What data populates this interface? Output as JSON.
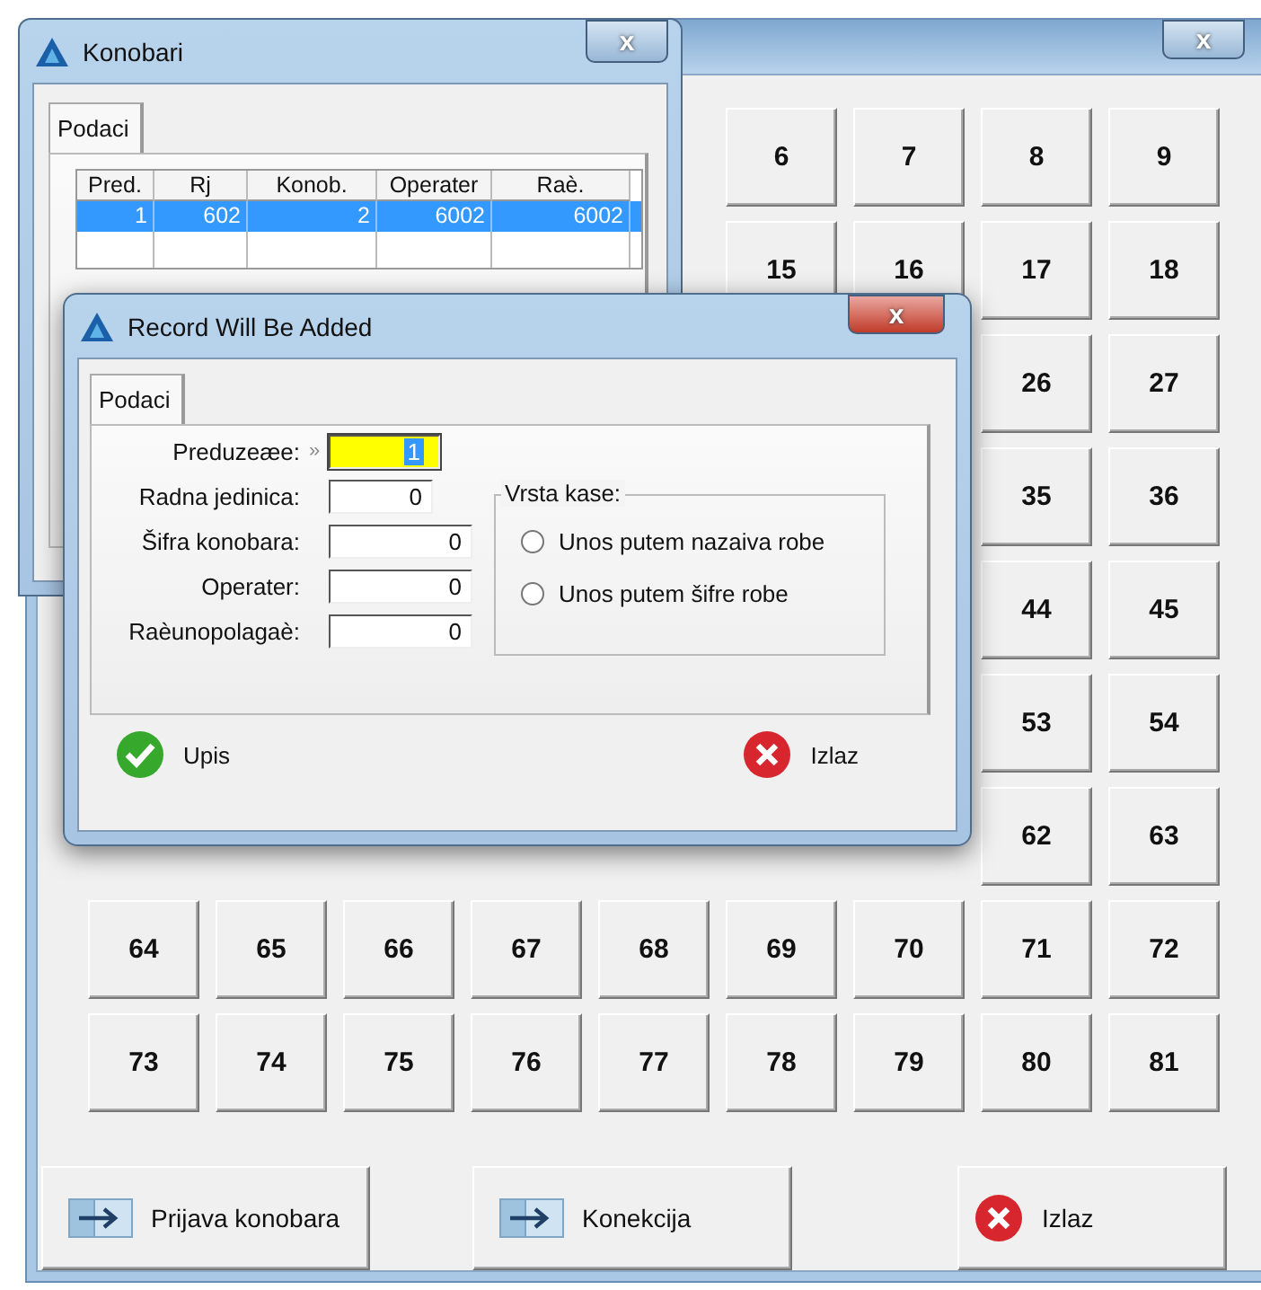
{
  "main_window": {
    "close": "x",
    "keypad": [
      [
        "6",
        "7",
        "8",
        "9"
      ],
      [
        "15",
        "16",
        "17",
        "18"
      ],
      [
        "26",
        "27"
      ],
      [
        "35",
        "36"
      ],
      [
        "44",
        "45"
      ],
      [
        "53",
        "54"
      ],
      [
        "62",
        "63"
      ],
      [
        "64",
        "65",
        "66",
        "67",
        "68",
        "69",
        "70",
        "71",
        "72"
      ],
      [
        "73",
        "74",
        "75",
        "76",
        "77",
        "78",
        "79",
        "80",
        "81"
      ]
    ],
    "buttons": [
      {
        "label": "Prijava konobara",
        "kind": "arrow"
      },
      {
        "label": "Konekcija",
        "kind": "arrow"
      },
      {
        "label": "Izlaz",
        "kind": "cancel"
      }
    ]
  },
  "konobari_window": {
    "title": "Konobari",
    "close": "x",
    "tabs": [
      {
        "label": "Podaci",
        "selected": true
      }
    ],
    "table": {
      "columns": [
        "Pred.",
        "Rj",
        "Konob.",
        "Operater",
        "Raè."
      ],
      "rows": [
        {
          "cells": [
            "1",
            "602",
            "2",
            "6002",
            "6002"
          ],
          "selected": true
        }
      ]
    }
  },
  "dialog": {
    "title": "Record Will Be Added",
    "close": "x",
    "tabs": [
      {
        "label": "Podaci",
        "selected": true
      }
    ],
    "fields": [
      {
        "label": "Preduzeæe:",
        "marker": "»",
        "value": "1",
        "focused": true
      },
      {
        "label": "Radna jedinica:",
        "value": "0",
        "focused": false
      },
      {
        "label": "Šifra konobara:",
        "value": "0",
        "focused": false
      },
      {
        "label": "Operater:",
        "value": "0",
        "focused": false
      },
      {
        "label": "Raèunopolagaè:",
        "value": "0",
        "focused": false
      }
    ],
    "group": {
      "title": "Vrsta kase:",
      "options": [
        {
          "label": "Unos putem nazaiva robe",
          "selected": false
        },
        {
          "label": "Unos putem šifre robe",
          "selected": false
        }
      ]
    },
    "buttons": [
      {
        "label": "Upis",
        "kind": "ok"
      },
      {
        "label": "Izlaz",
        "kind": "cancel"
      }
    ]
  }
}
